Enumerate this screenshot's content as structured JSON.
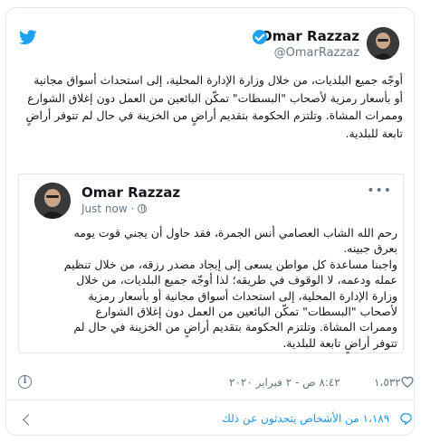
{
  "tweet": {
    "author_name": "Omar Razzaz",
    "author_handle": "@OmarRazzaz",
    "text": "أوجّه جميع البلديات، من خلال وزارة الإدارة المحلية، إلى استحداث أسواق مجانية\nأو بأسعار رمزية لأصحاب \"البسطات\" تمكّن البائعين من العمل دون إغلاق الشوارع\nوممرات المشاة. وتلتزم الحكومة بتقديم أراضٍ  من الخزينة في حال لم تتوفر أراضٍ\nتابعة للبلدية.",
    "icons": {
      "brand": "twitter-icon",
      "verified": "verified-badge-icon"
    }
  },
  "quoted": {
    "author_name": "Omar Razzaz",
    "time": "Just now",
    "text": "رحم الله الشاب العصامي أنس الجمرة، فقد حاول أن يجني قوت يومه\nبعرق جبينه.\nواجبنا مساعدة كل مواطن يسعى إلى إيجاد مصدر رزقه، من خلال تنظيم\nعمله ودعمه، لا الوقوف في طريقه؛ لذا أوجّه جميع البلديات، من خلال\nوزارة الإدارة المحلية، إلى استحداث أسواق مجانية أو بأسعار رمزية\nلأصحاب \"البسطات\" تمكّن البائعين من العمل دون إغلاق الشوارع\nوممرات المشاة. وتلتزم الحكومة بتقديم أراضٍ من الخزينة في حال لم\nتتوفر أراضٍ تابعة للبلدية."
  },
  "meta": {
    "timestamp": "٨:٤٢ ص - ٢ فبراير ٢٠٢٠",
    "likes": "١،٥٣٢"
  },
  "footer": {
    "people_talking": "١،١٨٩ من الأشخاص يتحدثون عن ذلك"
  },
  "colors": {
    "accent": "#1da1f2",
    "link": "#1b95e0",
    "muted": "#657786",
    "border": "#e1e8ed"
  }
}
